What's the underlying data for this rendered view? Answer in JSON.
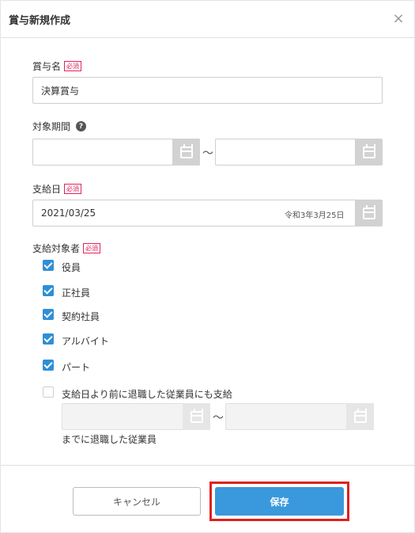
{
  "dialog": {
    "title": "賞与新規作成",
    "close_symbol": "×"
  },
  "required_badge": "必須",
  "bonus_name": {
    "label": "賞与名",
    "value": "決算賞与"
  },
  "target_period": {
    "label": "対象期間",
    "help_symbol": "?",
    "start_value": "",
    "end_value": "",
    "separator": "〜"
  },
  "payment_date": {
    "label": "支給日",
    "value": "2021/03/25",
    "wareki": "令和3年3月25日"
  },
  "recipients": {
    "label": "支給対象者",
    "options": [
      {
        "label": "役員",
        "checked": true
      },
      {
        "label": "正社員",
        "checked": true
      },
      {
        "label": "契約社員",
        "checked": true
      },
      {
        "label": "アルバイト",
        "checked": true
      },
      {
        "label": "パート",
        "checked": true
      }
    ],
    "retired": {
      "label": "支給日より前に退職した従業員にも支給",
      "checked": false,
      "start_value": "",
      "end_value": "",
      "separator": "〜",
      "note": "までに退職した従業員"
    }
  },
  "buttons": {
    "cancel": "キャンセル",
    "save": "保存"
  },
  "icons": {
    "calendar": "calendar-icon",
    "close": "close-icon",
    "help": "help-icon",
    "checkmark": "checkmark-icon"
  },
  "colors": {
    "primary": "#3a98dc",
    "required": "#e0245e",
    "highlight": "#e02020"
  }
}
